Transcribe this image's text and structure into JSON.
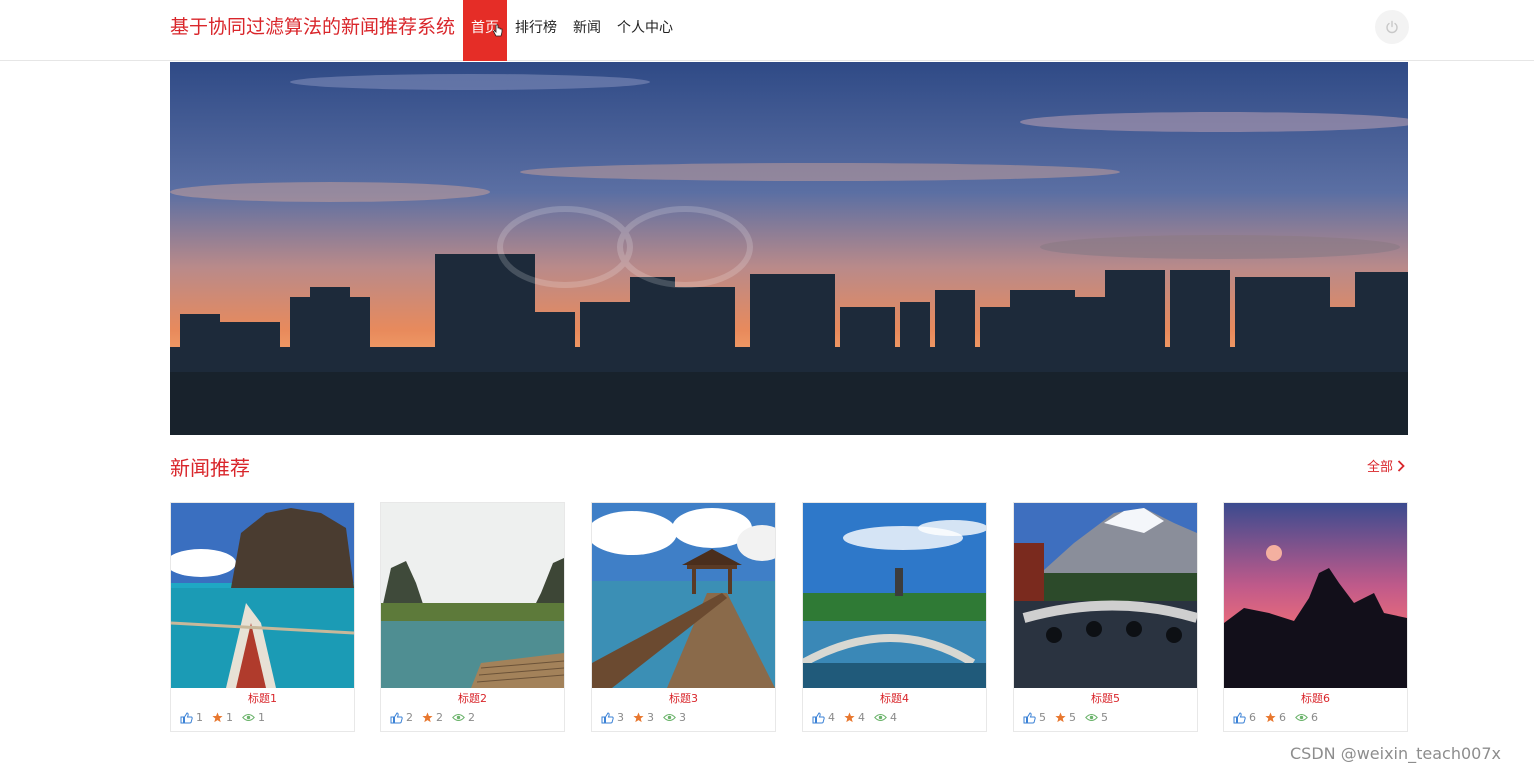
{
  "header": {
    "brand": "基于协同过滤算法的新闻推荐系统",
    "nav": [
      {
        "label": "首页"
      },
      {
        "label": "排行榜"
      },
      {
        "label": "新闻"
      },
      {
        "label": "个人中心"
      }
    ],
    "power_icon": "power-icon"
  },
  "section": {
    "title": "新闻推荐",
    "more_label": "全部"
  },
  "cards": [
    {
      "title": "标题1",
      "likes": "1",
      "stars": "1",
      "views": "1"
    },
    {
      "title": "标题2",
      "likes": "2",
      "stars": "2",
      "views": "2"
    },
    {
      "title": "标题3",
      "likes": "3",
      "stars": "3",
      "views": "3"
    },
    {
      "title": "标题4",
      "likes": "4",
      "stars": "4",
      "views": "4"
    },
    {
      "title": "标题5",
      "likes": "5",
      "stars": "5",
      "views": "5"
    },
    {
      "title": "标题6",
      "likes": "6",
      "stars": "6",
      "views": "6"
    }
  ],
  "colors": {
    "accent": "#e52d27",
    "like": "#3b82d6",
    "star": "#e8772e",
    "view": "#6bb36b"
  },
  "watermark": "CSDN @weixin_teach007x"
}
